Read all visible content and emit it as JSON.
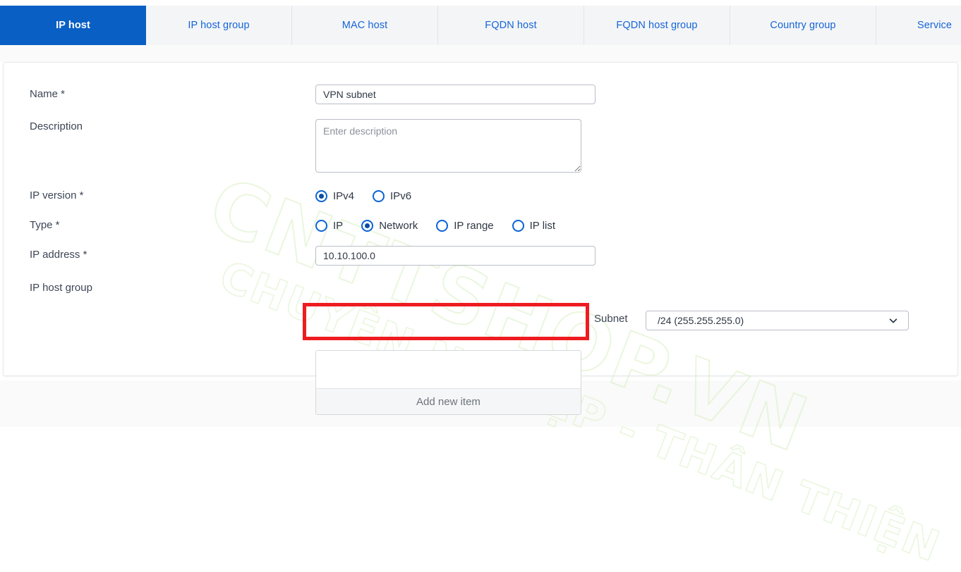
{
  "tabs": [
    {
      "label": "IP host",
      "active": true
    },
    {
      "label": "IP host group",
      "active": false
    },
    {
      "label": "MAC host",
      "active": false
    },
    {
      "label": "FQDN host",
      "active": false
    },
    {
      "label": "FQDN host group",
      "active": false
    },
    {
      "label": "Country group",
      "active": false
    },
    {
      "label": "Service",
      "active": false
    }
  ],
  "form": {
    "name_label": "Name *",
    "name_value": "VPN subnet",
    "description_label": "Description",
    "description_value": "",
    "description_placeholder": "Enter description",
    "ip_version_label": "IP version *",
    "ip_version_options": [
      {
        "label": "IPv4",
        "selected": true
      },
      {
        "label": "IPv6",
        "selected": false
      }
    ],
    "type_label": "Type *",
    "type_options": [
      {
        "label": "IP",
        "selected": false
      },
      {
        "label": "Network",
        "selected": true
      },
      {
        "label": "IP range",
        "selected": false
      },
      {
        "label": "IP list",
        "selected": false
      }
    ],
    "ip_address_label": "IP address *",
    "ip_address_value": "10.10.100.0",
    "subnet_label": "Subnet",
    "subnet_value": "/24 (255.255.255.0)",
    "ip_host_group_label": "IP host group",
    "add_new_item_label": "Add new item"
  },
  "watermark": {
    "line1": "CNTTSHOP.VN",
    "line2": "CHUYÊN NGHIỆP - THÂN THIỆN"
  },
  "colors": {
    "accent": "#0a5fc4",
    "tab_link": "#1565d8",
    "radio": "#0b63d6",
    "highlight_box": "#ee1c20",
    "watermark": "#d9f0c4"
  }
}
